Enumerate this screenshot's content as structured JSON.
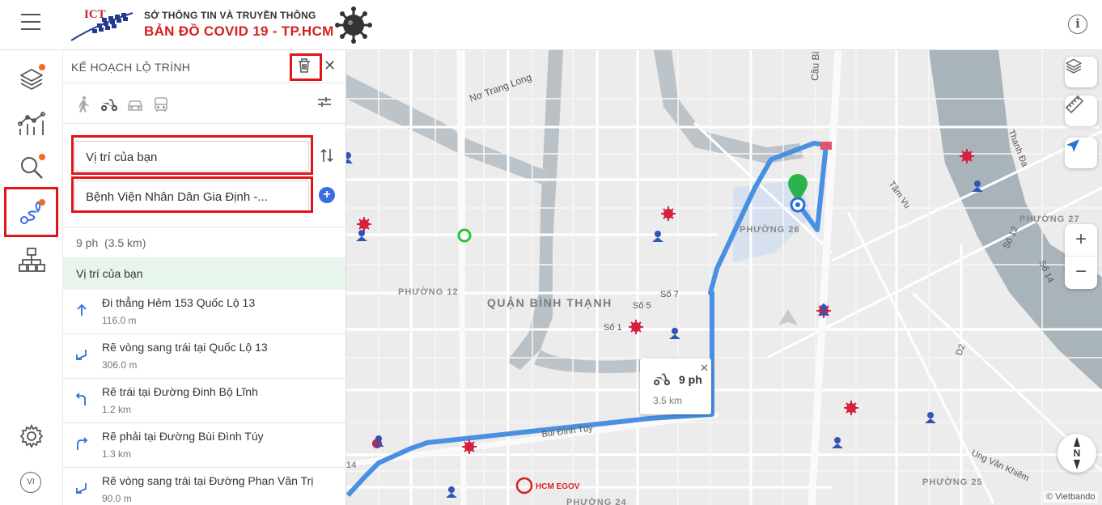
{
  "header": {
    "logo_text": "ICT",
    "subtitle": "SỞ THÔNG TIN VÀ TRUYỀN THÔNG",
    "title": "BẢN ĐỒ  COVID 19 - TP.HCM"
  },
  "sidebar": {
    "items": [
      {
        "icon": "layers-icon",
        "has_dot": true
      },
      {
        "icon": "chart-icon",
        "has_dot": false
      },
      {
        "icon": "search-icon",
        "has_dot": true
      },
      {
        "icon": "route-icon",
        "has_dot": true,
        "active": true
      },
      {
        "icon": "network-icon",
        "has_dot": false
      }
    ],
    "language": "VI"
  },
  "panel": {
    "title": "KẾ HOẠCH LỘ TRÌNH",
    "modes": [
      "walk-icon",
      "motorbike-icon",
      "car-icon",
      "bus-icon"
    ],
    "origin": "Vị trí của bạn",
    "destination": "Bệnh Viện Nhân Dân Gia Định -...",
    "summary_time": "9 ph",
    "summary_distance": "(3.5 km)",
    "start_label": "Vị trí của bạn",
    "steps": [
      {
        "text": "Đi thẳng Hẻm 153 Quốc Lộ 13",
        "distance": "116.0 m",
        "icon": "arrow-up-icon"
      },
      {
        "text": "Rẽ vòng sang trái tại Quốc Lộ 13",
        "distance": "306.0 m",
        "icon": "sharp-left-icon"
      },
      {
        "text": "Rẽ trái tại Đường Đinh Bộ Lĩnh",
        "distance": "1.2 km",
        "icon": "turn-left-icon"
      },
      {
        "text": "Rẽ phải tại Đường Bùi Đình Túy",
        "distance": "1.3 km",
        "icon": "turn-right-icon"
      },
      {
        "text": "Rẽ vòng sang trái tại Đường Phan Văn Trị",
        "distance": "90.0 m",
        "icon": "sharp-left-icon"
      }
    ]
  },
  "map": {
    "labels": {
      "no_trang_long": "Nơ Trang Long",
      "cau_binh": "Cầu Bì",
      "tam_vu": "Tầm Vu",
      "thanh_da": "Thanh Đa",
      "phuong_26": "PHƯỜNG 26",
      "phuong_27": "PHƯỜNG 27",
      "phuong_12": "PHƯỜNG 12",
      "quan": "QUẬN BÌNH THẠNH",
      "so_7": "Số 7",
      "so_5": "Số 5",
      "so_1": "Số 1",
      "so_12": "Số 12",
      "so_14": "Số 14",
      "d2": "D2",
      "bui_dinh_tuy": "Bùi Đình Túy",
      "ung_van_khiem": "Ung Văn Khiêm",
      "phuong_25": "PHƯỜNG 25",
      "phuong_24": "PHƯỜNG 24",
      "num_14": "14",
      "hcm_egov": "HCM EGOV",
      "compass_n": "N",
      "attribution": "© Vietbando"
    },
    "popup": {
      "time": "9 ph",
      "distance": "3.5 km"
    },
    "route_color": "#4a90e2",
    "accent": "#d6211e"
  }
}
